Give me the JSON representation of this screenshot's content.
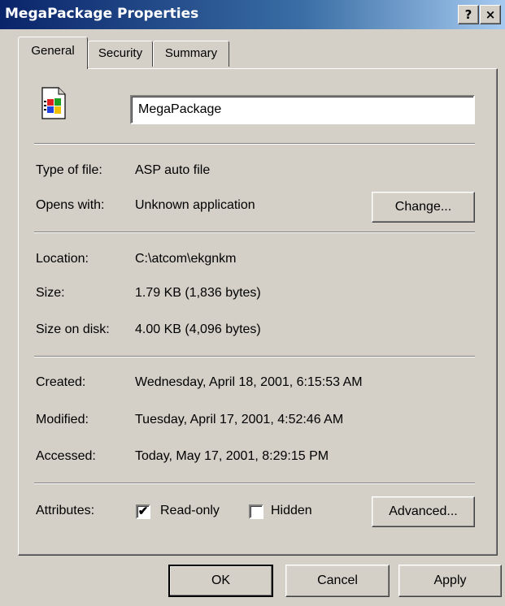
{
  "window": {
    "title": "MegaPackage Properties",
    "help_glyph": "?",
    "close_glyph": "×"
  },
  "tabs": [
    {
      "label": "General",
      "active": true
    },
    {
      "label": "Security",
      "active": false
    },
    {
      "label": "Summary",
      "active": false
    }
  ],
  "file": {
    "name": "MegaPackage",
    "icon": "windows-file-icon"
  },
  "info": {
    "type_label": "Type of file:",
    "type_value": "ASP auto file",
    "opens_label": "Opens with:",
    "opens_value": "Unknown application",
    "change_button": "Change...",
    "location_label": "Location:",
    "location_value": "C:\\atcom\\ekgnkm",
    "size_label": "Size:",
    "size_value": "1.79 KB (1,836 bytes)",
    "size_disk_label": "Size on disk:",
    "size_disk_value": "4.00 KB (4,096 bytes)",
    "created_label": "Created:",
    "created_value": "Wednesday, April 18, 2001, 6:15:53 AM",
    "modified_label": "Modified:",
    "modified_value": "Tuesday, April 17, 2001, 4:52:46 AM",
    "accessed_label": "Accessed:",
    "accessed_value": "Today, May 17, 2001, 8:29:15 PM"
  },
  "attributes": {
    "label": "Attributes:",
    "readonly_label": "Read-only",
    "readonly_checked": true,
    "readonly_mark": "✔",
    "hidden_label": "Hidden",
    "hidden_checked": false,
    "advanced_button": "Advanced..."
  },
  "footer": {
    "ok": "OK",
    "cancel": "Cancel",
    "apply": "Apply"
  },
  "colors": {
    "titlebar_start": "#0a246a",
    "titlebar_end": "#a6caf0",
    "face": "#d4d0c8"
  }
}
